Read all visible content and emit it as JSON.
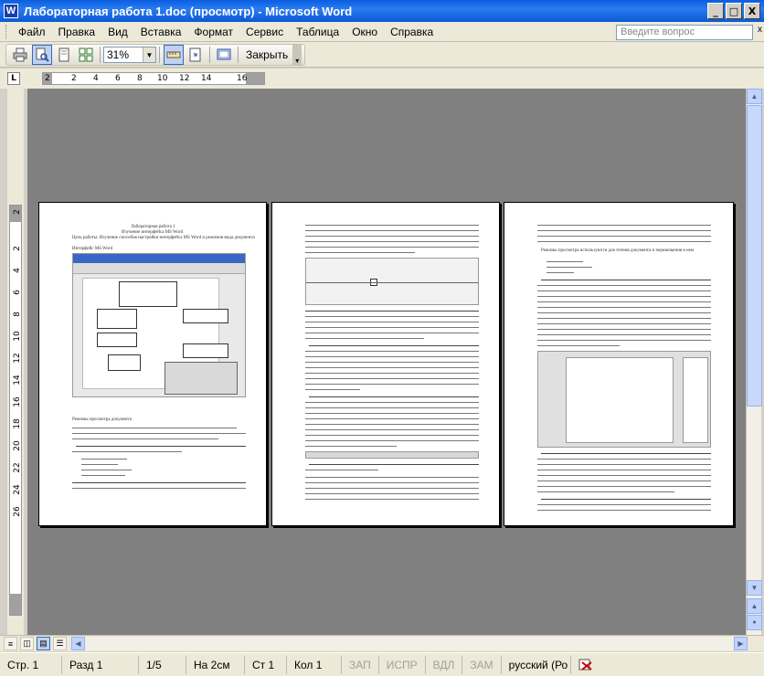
{
  "window": {
    "title": "Лабораторная работа 1.doc (просмотр) - Microsoft Word",
    "app_icon_letter": "W",
    "minimize": "_",
    "maximize": "□",
    "close": "X"
  },
  "menu": {
    "items": [
      "Файл",
      "Правка",
      "Вид",
      "Вставка",
      "Формат",
      "Сервис",
      "Таблица",
      "Окно",
      "Справка"
    ],
    "help_placeholder": "Введите вопрос",
    "help_close": "x"
  },
  "toolbar": {
    "zoom_value": "31%",
    "close_label": "Закрыть"
  },
  "ruler": {
    "corner": "L",
    "h_ticks": [
      "2",
      "2",
      "4",
      "6",
      "8",
      "10",
      "12",
      "14",
      "16"
    ],
    "v_ticks": [
      "2",
      "2",
      "4",
      "6",
      "8",
      "10",
      "12",
      "14",
      "16",
      "18",
      "20",
      "22",
      "24",
      "26"
    ]
  },
  "pages": {
    "page1_title": "Лабораторная работа 1",
    "page1_subtitle": "Изучение интерфейса MS Word",
    "page1_goal": "Цель работы: Изучение способов настройки интерфейса MS Word и режимов вида документа",
    "page1_tool": "Интерфейс MS Word",
    "page1_section": "Режимы просмотра документа",
    "page3_heading": "Режимы просмотра используются для чтения документа и перемещения в нем"
  },
  "statusbar": {
    "page": "Стр. 1",
    "section": "Разд 1",
    "pages": "1/5",
    "position": "На 2см",
    "line": "Ст 1",
    "column": "Кол 1",
    "rec": "ЗАП",
    "trk": "ИСПР",
    "ext": "ВДЛ",
    "ovr": "ЗАМ",
    "language": "русский (Ро"
  }
}
